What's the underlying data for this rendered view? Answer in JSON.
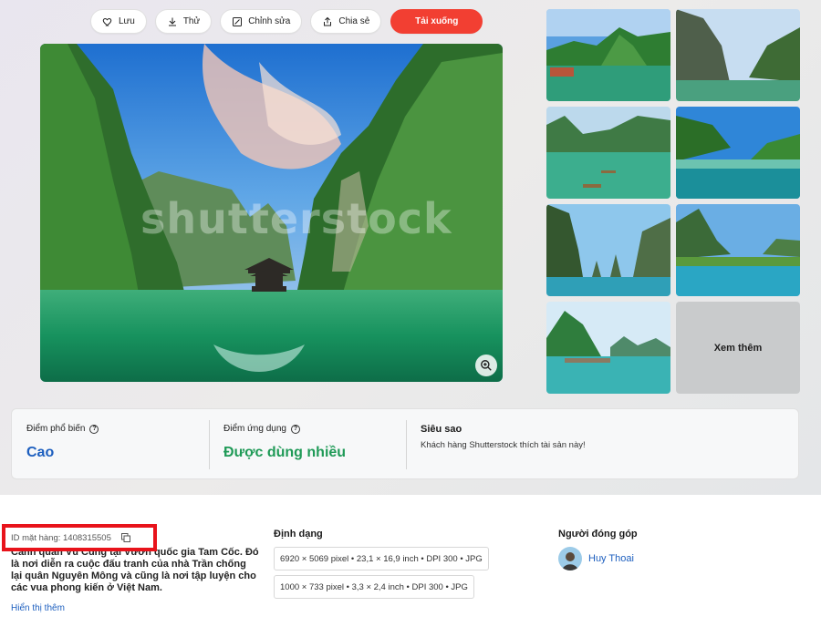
{
  "toolbar": {
    "save_label": "Lưu",
    "try_label": "Thử",
    "edit_label": "Chỉnh sửa",
    "share_label": "Chia sẻ",
    "download_label": "Tải xuống"
  },
  "main_image": {
    "watermark": "shutterstock"
  },
  "related": {
    "see_more_label": "Xem thêm"
  },
  "stats": {
    "popularity_label": "Điểm phổ biến",
    "popularity_value": "Cao",
    "usage_label": "Điểm ứng dụng",
    "usage_value": "Được dùng nhiều",
    "superstar_title": "Siêu sao",
    "superstar_desc": "Khách hàng Shutterstock thích tài sản này!"
  },
  "details": {
    "item_id": "ID mặt hàng: 1408315505",
    "description": "Cảnh quan Vũ Cung tại Vườn quốc gia Tam Cốc. Đó là nơi diễn ra cuộc đấu tranh của nhà Trần chống lại quân Nguyên Mông và cũng là nơi tập luyện cho các vua phong kiến ở Việt Nam.",
    "show_more": "Hiển thị thêm",
    "format_title": "Định dạng",
    "formats": [
      "6920 × 5069 pixel • 23,1 × 16,9 inch • DPI 300 • JPG",
      "1000 × 733 pixel • 3,3 × 2,4 inch • DPI 300 • JPG"
    ],
    "contributor_title": "Người đóng góp",
    "contributor_name": "Huy Thoai"
  },
  "colors": {
    "accent_red": "#f23f32",
    "link_blue": "#1d5fbf",
    "green": "#1f9a57",
    "highlight_red": "#e8131b"
  }
}
